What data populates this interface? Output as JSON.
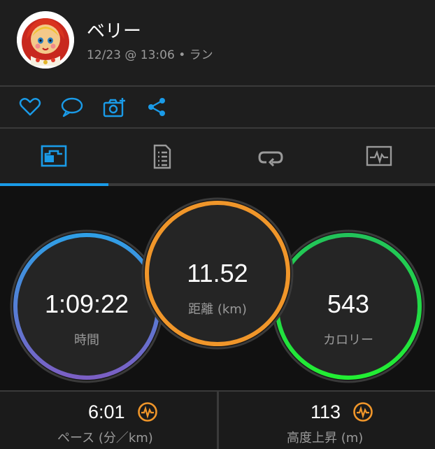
{
  "header": {
    "user_name": "ベリー",
    "activity_meta": "12/23 @ 13:06 • ラン"
  },
  "colors": {
    "accent": "#1a9be8",
    "time_ring_top": "#2f9fe6",
    "time_ring_bottom": "#7b5fc4",
    "distance_ring": "#f0962a",
    "calories_ring": "#22dd44",
    "gauge_icon": "#f0962a"
  },
  "actions": [
    {
      "icon": "heart-icon"
    },
    {
      "icon": "comment-icon"
    },
    {
      "icon": "add-photo-icon"
    },
    {
      "icon": "share-icon"
    }
  ],
  "tabs": [
    {
      "icon": "overview-icon",
      "active": true
    },
    {
      "icon": "details-icon",
      "active": false
    },
    {
      "icon": "laps-icon",
      "active": false
    },
    {
      "icon": "charts-icon",
      "active": false
    }
  ],
  "stats": {
    "time": {
      "value": "1:09:22",
      "label": "時間"
    },
    "distance": {
      "value": "11.52",
      "label": "距離 (km)"
    },
    "calories": {
      "value": "543",
      "label": "カロリー"
    }
  },
  "bottom": {
    "pace": {
      "value": "6:01",
      "label": "ペース (分／km)",
      "icon": "gauge-icon"
    },
    "elevation": {
      "value": "113",
      "label": "高度上昇 (m)",
      "icon": "gauge-icon"
    }
  }
}
